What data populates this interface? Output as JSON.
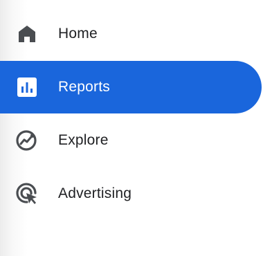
{
  "nav": {
    "items": [
      {
        "label": "Home",
        "icon": "home-icon",
        "active": false
      },
      {
        "label": "Reports",
        "icon": "reports-icon",
        "active": true
      },
      {
        "label": "Explore",
        "icon": "explore-icon",
        "active": false
      },
      {
        "label": "Advertising",
        "icon": "advertising-icon",
        "active": false
      }
    ]
  },
  "colors": {
    "active_background": "#1a66dc",
    "active_text": "#ffffff",
    "text": "#202124",
    "icon": "#5f6368"
  }
}
